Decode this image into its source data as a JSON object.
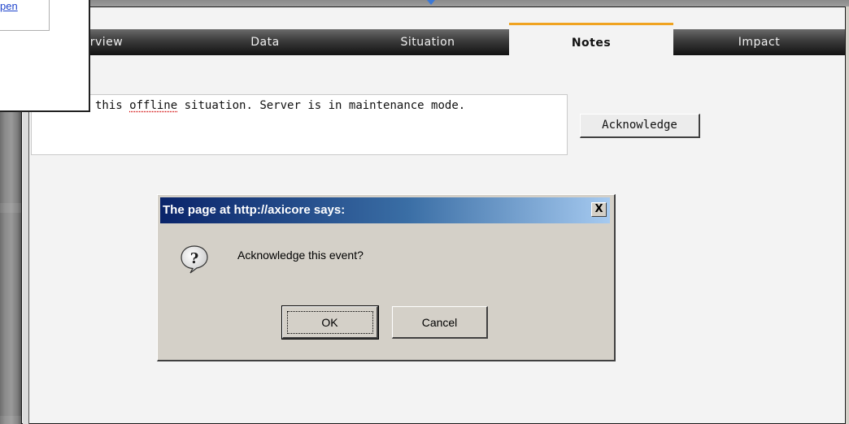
{
  "popup": {
    "link_text": "pen"
  },
  "tabs": [
    {
      "label": "rview",
      "active": false
    },
    {
      "label": "Data",
      "active": false
    },
    {
      "label": "Situation",
      "active": false
    },
    {
      "label": "Notes",
      "active": true
    },
    {
      "label": "Impact",
      "active": false
    }
  ],
  "notes": {
    "text_prefix": "this ",
    "text_misspelled": "offline",
    "text_suffix": " situation. Server is in maintenance mode."
  },
  "acknowledge_button": {
    "label": "Acknowledge"
  },
  "dialog": {
    "title": "The page at http://axicore says:",
    "close_label": "X",
    "message": "Acknowledge this event?",
    "icon": "question-icon",
    "ok_label": "OK",
    "cancel_label": "Cancel"
  },
  "colors": {
    "active_tab_accent": "#f0a320",
    "titlebar_start": "#0a246a",
    "titlebar_end": "#a6caf0",
    "link": "#1f44cc"
  }
}
